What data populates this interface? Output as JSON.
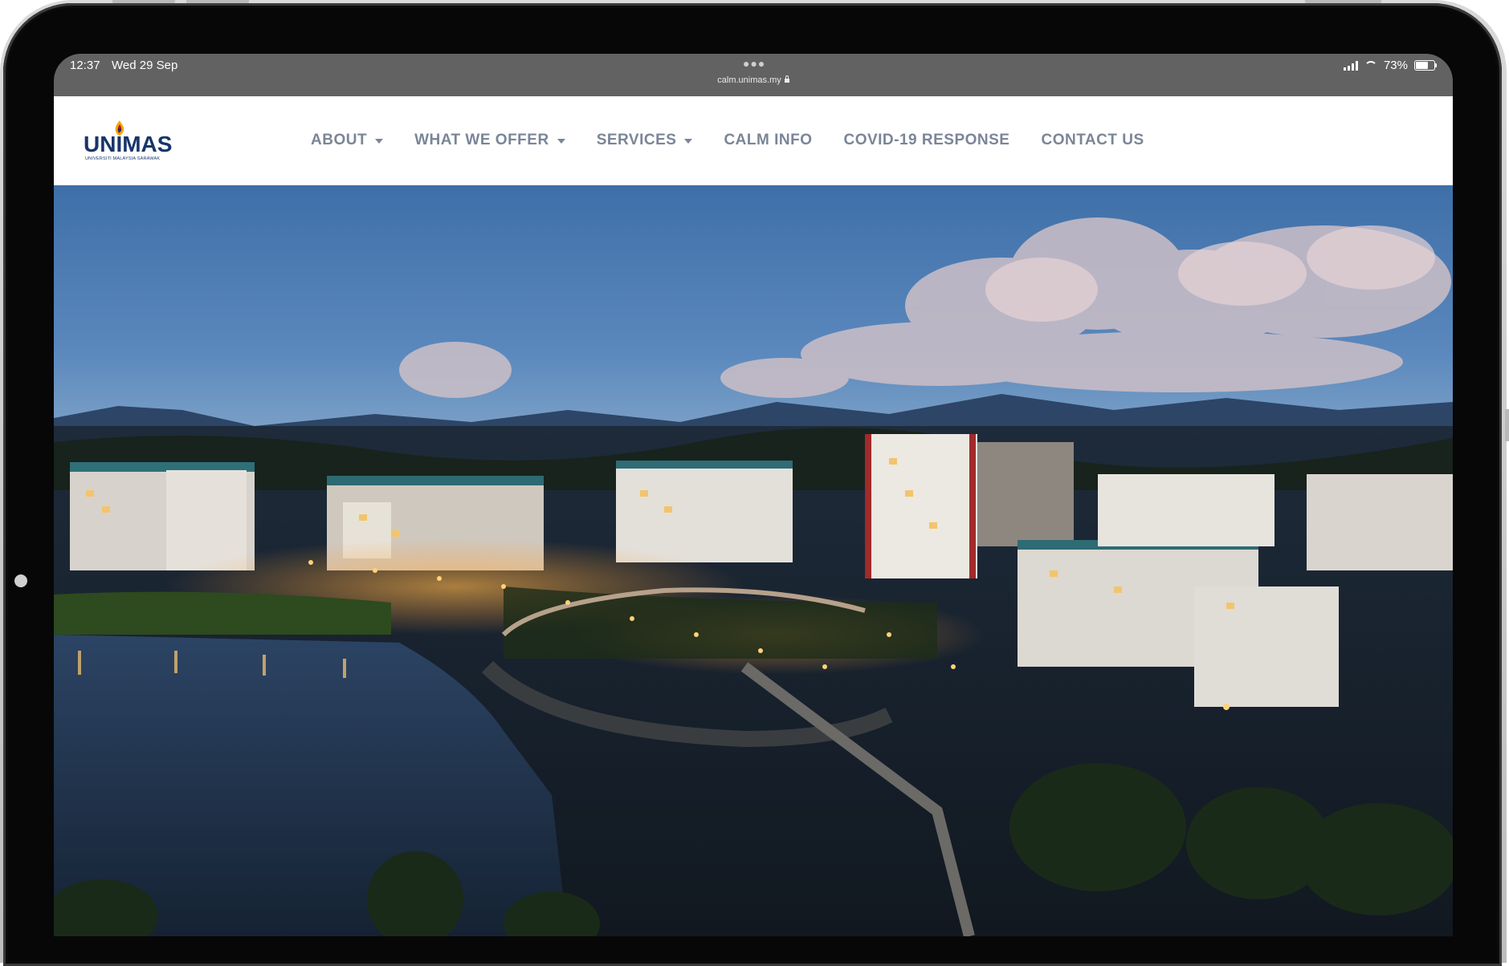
{
  "status_bar": {
    "time": "12:37",
    "date": "Wed 29 Sep",
    "url": "calm.unimas.my",
    "battery": "73%",
    "battery_level": 0.73
  },
  "site": {
    "logo_text": "UNIMAS",
    "logo_subtitle": "UNIVERSITI MALAYSIA SARAWAK",
    "nav": [
      {
        "label": "ABOUT",
        "has_dropdown": true
      },
      {
        "label": "WHAT WE OFFER",
        "has_dropdown": true
      },
      {
        "label": "SERVICES",
        "has_dropdown": true
      },
      {
        "label": "CALM INFO",
        "has_dropdown": false
      },
      {
        "label": "COVID-19 RESPONSE",
        "has_dropdown": false
      },
      {
        "label": "CONTACT US",
        "has_dropdown": false
      }
    ]
  },
  "colors": {
    "nav_text": "#7a8597",
    "brand_blue": "#18356b",
    "brand_red": "#c8102e",
    "brand_gold": "#f2a900",
    "status_bar_bg": "#626262"
  },
  "icons": [
    "cellular-signal-icon",
    "wifi-icon",
    "battery-icon",
    "lock-icon",
    "caret-down-icon",
    "more-dots-icon"
  ]
}
